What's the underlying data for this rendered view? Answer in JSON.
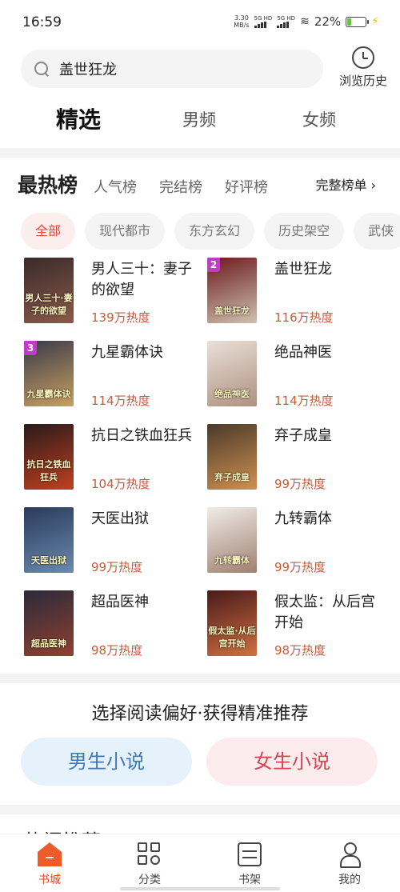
{
  "status_bar": {
    "time": "16:59",
    "net_speed_value": "3.30",
    "net_speed_unit": "MB/s",
    "sim1": "5G HD",
    "sim2": "5G HD",
    "battery_percent": "22%",
    "battery_level": 0.22,
    "battery_color": "#6cc04a"
  },
  "search": {
    "query": "盖世狂龙",
    "history_label": "浏览历史",
    "history_icon": "clock-icon"
  },
  "top_tabs": [
    {
      "label": "精选",
      "active": true
    },
    {
      "label": "男频",
      "active": false
    },
    {
      "label": "女频",
      "active": false
    }
  ],
  "ranking": {
    "title": "最热榜",
    "tabs": [
      "人气榜",
      "完结榜",
      "好评榜"
    ],
    "full_list_label": "完整榜单 ›"
  },
  "categories": [
    {
      "label": "全部",
      "active": true
    },
    {
      "label": "现代都市",
      "active": false
    },
    {
      "label": "东方玄幻",
      "active": false
    },
    {
      "label": "历史架空",
      "active": false
    },
    {
      "label": "武侠",
      "active": false
    }
  ],
  "books": [
    {
      "title": "男人三十：妻子的欲望",
      "heat": "139万热度",
      "rank": "",
      "cover_text": "男人三十·妻子的欲望",
      "cover_colors": [
        "#3a2a2a",
        "#8a5a4a"
      ]
    },
    {
      "title": "盖世狂龙",
      "heat": "116万热度",
      "rank": "2",
      "cover_text": "盖世狂龙",
      "cover_colors": [
        "#6a1a1a",
        "#d0c0b0"
      ]
    },
    {
      "title": "九星霸体诀",
      "heat": "114万热度",
      "rank": "3",
      "cover_text": "九星霸体诀",
      "cover_colors": [
        "#3a3a4a",
        "#c8a060"
      ]
    },
    {
      "title": "绝品神医",
      "heat": "114万热度",
      "rank": "",
      "cover_text": "绝品神医",
      "cover_colors": [
        "#e8e0d8",
        "#b09080"
      ]
    },
    {
      "title": "抗日之铁血狂兵",
      "heat": "104万热度",
      "rank": "",
      "cover_text": "抗日之铁血狂兵",
      "cover_colors": [
        "#2a1a1a",
        "#c04020"
      ]
    },
    {
      "title": "弃子成皇",
      "heat": "99万热度",
      "rank": "",
      "cover_text": "弃子成皇",
      "cover_colors": [
        "#4a3a2a",
        "#d09050"
      ]
    },
    {
      "title": "天医出狱",
      "heat": "99万热度",
      "rank": "",
      "cover_text": "天医出狱",
      "cover_colors": [
        "#2a3a5a",
        "#6a8ab0"
      ]
    },
    {
      "title": "九转霸体",
      "heat": "99万热度",
      "rank": "",
      "cover_text": "九转霸体",
      "cover_colors": [
        "#f0ece8",
        "#a08070"
      ]
    },
    {
      "title": "超品医神",
      "heat": "98万热度",
      "rank": "",
      "cover_text": "超品医神",
      "cover_colors": [
        "#2a2a3a",
        "#904030"
      ]
    },
    {
      "title": "假太监：从后宫开始",
      "heat": "98万热度",
      "rank": "",
      "cover_text": "假太监·从后宫开始",
      "cover_colors": [
        "#4a1a1a",
        "#d07040"
      ]
    }
  ],
  "preference": {
    "title": "选择阅读偏好·获得精准推荐",
    "male_label": "男生小说",
    "female_label": "女生小说"
  },
  "hot_recommend_label": "热门推荐",
  "bottom_nav": [
    {
      "label": "书城",
      "icon": "home-icon",
      "active": true
    },
    {
      "label": "分类",
      "icon": "grid-icon",
      "active": false
    },
    {
      "label": "书架",
      "icon": "shelf-icon",
      "active": false
    },
    {
      "label": "我的",
      "icon": "user-icon",
      "active": false
    }
  ]
}
